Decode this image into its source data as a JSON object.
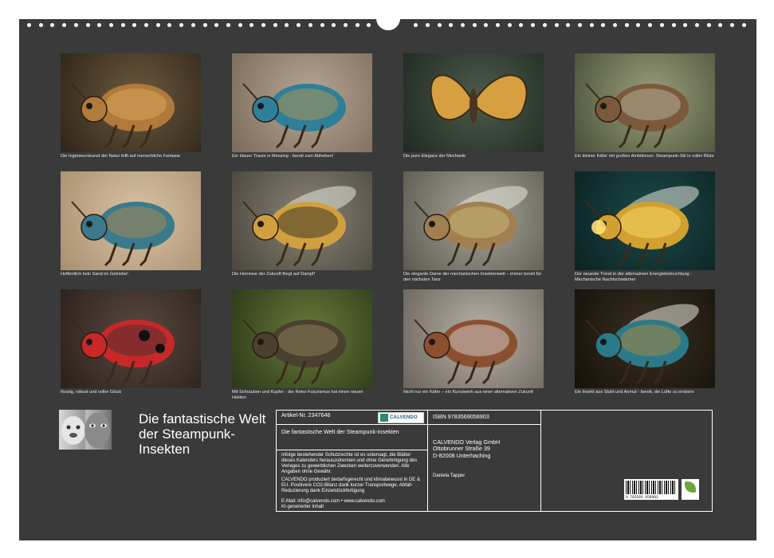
{
  "tiles": [
    {
      "caption": "Die Ingenieurskunst der Natur trifft auf menschliche Fantasie",
      "bg1": "#6b5a3e",
      "bg2": "#2e2418",
      "bug": "beetle-brass"
    },
    {
      "caption": "Ein blauer Traum in Messing - bereit zum Abheben!",
      "bg1": "#b7a796",
      "bg2": "#7a6a5a",
      "bug": "beetle-blue"
    },
    {
      "caption": "Die pure Eleganz der Mechanik",
      "bg1": "#4c5a4a",
      "bg2": "#1f2a22",
      "bug": "butterfly"
    },
    {
      "caption": "Ein kleiner Käfer mit großen Ambitionen: Steampunk-Stil in voller Blüte",
      "bg1": "#9aa07a",
      "bg2": "#4a503a",
      "bug": "ant-mech"
    },
    {
      "caption": "Hoffentlich kein Sand im Getriebe!",
      "bg1": "#d9c3a5",
      "bg2": "#a98f70",
      "bug": "beetle-sand"
    },
    {
      "caption": "Die Hornisse der Zukunft fliegt auf Dampf!",
      "bg1": "#8a8476",
      "bg2": "#4a463c",
      "bug": "hornet"
    },
    {
      "caption": "Die elegante Dame der mechanischen Insektenwelt – immer bereit für den nächsten Tanz",
      "bg1": "#a8a69a",
      "bg2": "#5c5a50",
      "bug": "mantis"
    },
    {
      "caption": "Der neueste Trend in der alternativen Energiebeleuchtung - Mechanische Nachtschwärmer",
      "bg1": "#1c4a4a",
      "bg2": "#0c2222",
      "bug": "firefly"
    },
    {
      "caption": "Rostig, robust und voller Glück",
      "bg1": "#5a4a40",
      "bg2": "#2a201a",
      "bug": "ladybug"
    },
    {
      "caption": "Mit Schrauben und Kupfer - der Retro-Futurismus hat einen neuen Helden",
      "bg1": "#6a7a3a",
      "bg2": "#2a3818",
      "bug": "ant-forest"
    },
    {
      "caption": "Nicht nur ein Käfer – ein Kunstwerk aus einer alternativen Zukunft",
      "bg1": "#b8b2a8",
      "bg2": "#6a645c",
      "bug": "stag-beetle"
    },
    {
      "caption": "Ein Insekt aus Stahl und Anmut - bereit, die Lüfte zu erobern",
      "bg1": "#3a3020",
      "bg2": "#15110a",
      "bug": "wasp-steel"
    }
  ],
  "calendar": {
    "title": "Die fantastische Welt der Steampunk-Insekten",
    "article_no": "Artikel-Nr. 2347646",
    "product_title": "Die fantastische Welt der Steampunk-Insekten",
    "copyright_text": "Infolge bestehender Schutzrechte ist es untersagt, die Blätter dieses Kalenders herauszutrennen und ohne Genehmigung des Verlages zu gewerblichen Zwecken weiterzuverwenden. Alle Angaben ohne Gewähr.",
    "eco_text": "CALVENDO produziert bedarfsgerecht und klimabewusst in DE & EU. Positivere CO2-Bilanz dank kurzer Transportwege. Abfall-Reduzierung dank Einzelstückfertigung",
    "contact": "E-Mail: info@calvendo.com • www.calvendo.com",
    "ai_note": "KI-generierter Inhalt",
    "isbn": "ISBN 9783569058903",
    "publisher_name": "CALVENDO Verlag GmbH",
    "publisher_street": "Ottobrunner Straße 39",
    "publisher_city": "D-82008 Unterhaching",
    "author": "Daniela Tapper",
    "logo_text": "CALVENDO",
    "barcode_number": "9 783569 058903"
  }
}
